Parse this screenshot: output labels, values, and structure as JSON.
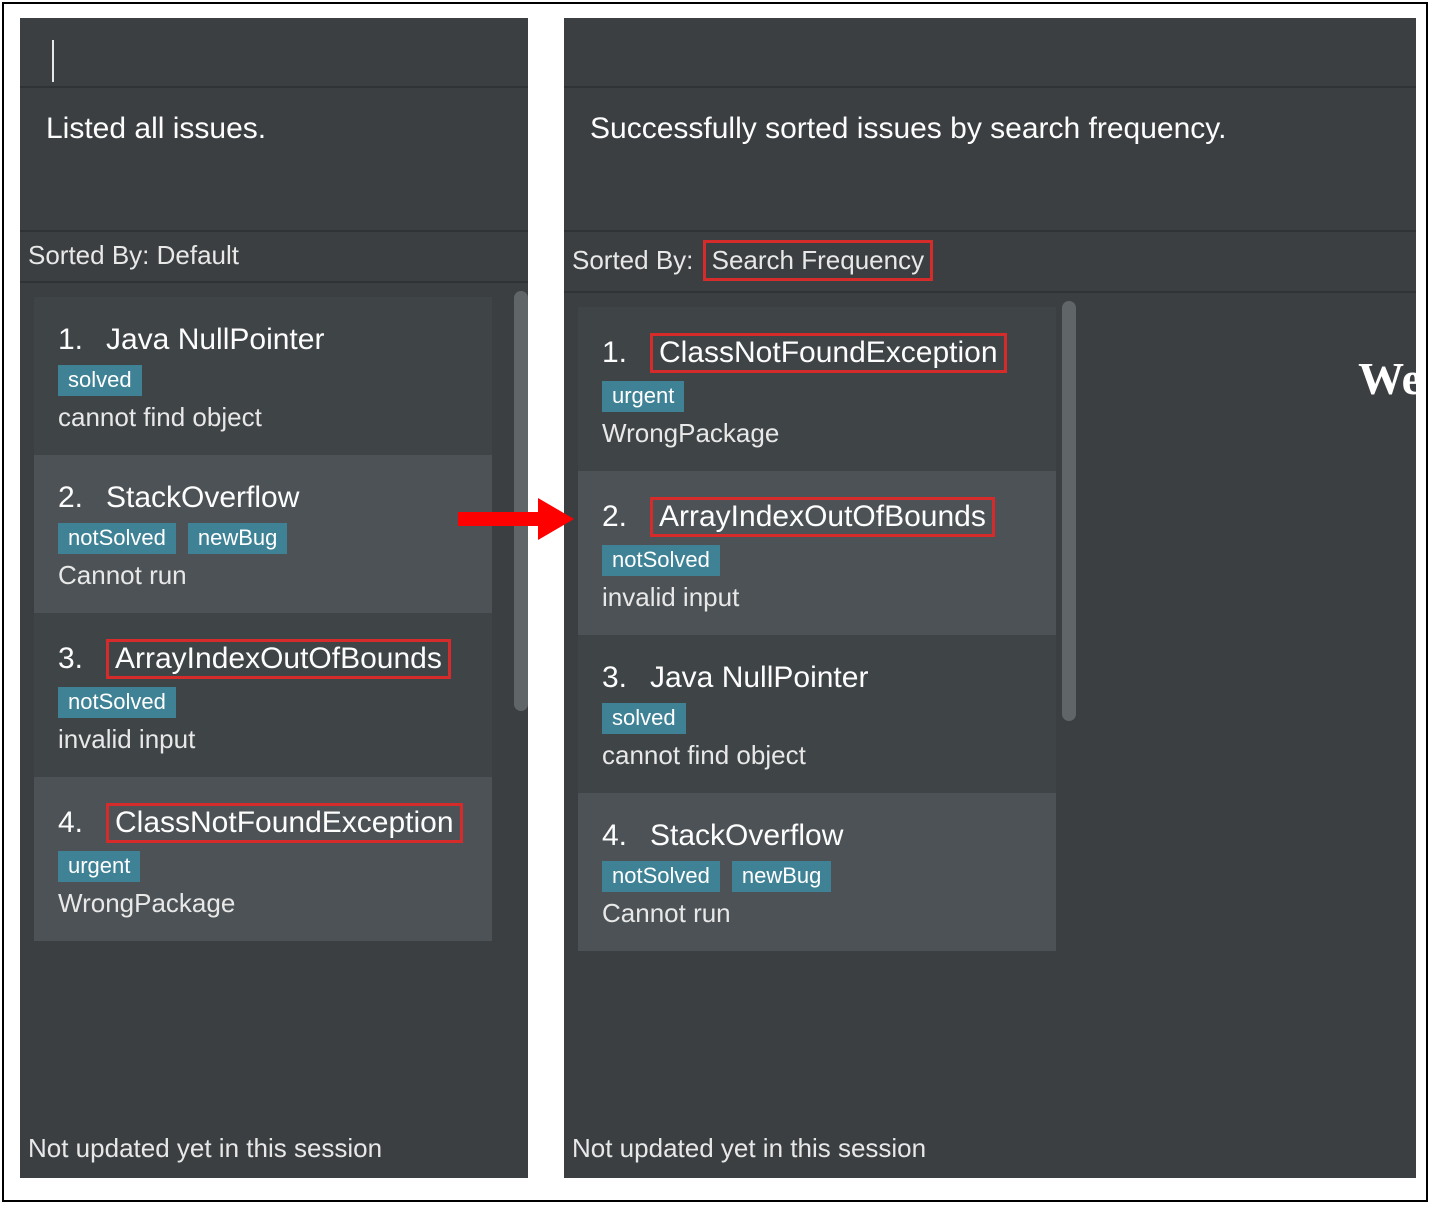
{
  "arrow": {
    "present": true
  },
  "left": {
    "statusMessage": "Listed all issues.",
    "sortedByLabel": "Sorted By: ",
    "sortedByValue": "Default",
    "sortedByHighlighted": false,
    "footer": "Not updated yet in this session",
    "issues": [
      {
        "index": "1.",
        "title": "Java NullPointer",
        "highlighted": false,
        "tags": [
          "solved"
        ],
        "description": "cannot find object",
        "alt": 0
      },
      {
        "index": "2.",
        "title": "StackOverflow",
        "highlighted": false,
        "tags": [
          "notSolved",
          "newBug"
        ],
        "description": "Cannot run",
        "alt": 1
      },
      {
        "index": "3.",
        "title": "ArrayIndexOutOfBounds",
        "highlighted": true,
        "tags": [
          "notSolved"
        ],
        "description": "invalid input",
        "alt": 0
      },
      {
        "index": "4.",
        "title": "ClassNotFoundException",
        "highlighted": true,
        "tags": [
          "urgent"
        ],
        "description": "WrongPackage",
        "alt": 1
      }
    ]
  },
  "right": {
    "statusMessage": "Successfully sorted issues by search frequency.",
    "sortedByLabel": "Sorted By: ",
    "sortedByValue": "Search Frequency",
    "sortedByHighlighted": true,
    "footer": "Not updated yet in this session",
    "extraRightText": "We",
    "issues": [
      {
        "index": "1.",
        "title": "ClassNotFoundException",
        "highlighted": true,
        "tags": [
          "urgent"
        ],
        "description": "WrongPackage",
        "alt": 0
      },
      {
        "index": "2.",
        "title": "ArrayIndexOutOfBounds",
        "highlighted": true,
        "tags": [
          "notSolved"
        ],
        "description": "invalid input",
        "alt": 1
      },
      {
        "index": "3.",
        "title": "Java NullPointer",
        "highlighted": false,
        "tags": [
          "solved"
        ],
        "description": "cannot find object",
        "alt": 0
      },
      {
        "index": "4.",
        "title": "StackOverflow",
        "highlighted": false,
        "tags": [
          "notSolved",
          "newBug"
        ],
        "description": "Cannot run",
        "alt": 1
      }
    ]
  }
}
